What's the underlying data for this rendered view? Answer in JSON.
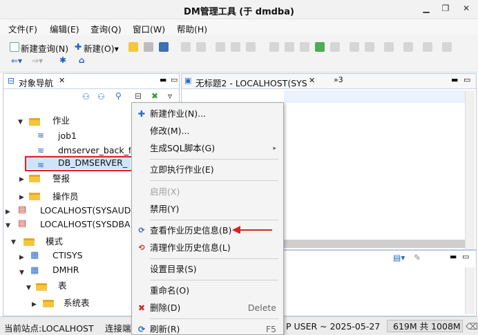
{
  "window": {
    "title": "DM管理工具 (于 dmdba)",
    "min_icon": "minimize-icon",
    "restore_icon": "restore-icon",
    "close_icon": "close-icon"
  },
  "menubar": [
    "文件(F)",
    "编辑(E)",
    "查询(Q)",
    "窗口(W)",
    "帮助(H)"
  ],
  "toolbar": {
    "new_query": "新建查询(N)",
    "new": "新建(O)▾"
  },
  "left_panel": {
    "tab_title": "对象导航",
    "tree": [
      {
        "label": "作业",
        "kind": "folder"
      },
      {
        "label": "job1",
        "kind": "job"
      },
      {
        "label": "dmserver_back_full",
        "kind": "job"
      },
      {
        "label": "DB_DMSERVER_",
        "kind": "job",
        "selected": true
      },
      {
        "label": "警报",
        "kind": "folder"
      },
      {
        "label": "操作员",
        "kind": "folder"
      },
      {
        "label": "LOCALHOST(SYSAUD",
        "kind": "server"
      },
      {
        "label": "LOCALHOST(SYSDBA",
        "kind": "server"
      },
      {
        "label": "模式",
        "kind": "folder"
      },
      {
        "label": "CTISYS",
        "kind": "schema"
      },
      {
        "label": "DMHR",
        "kind": "schema"
      },
      {
        "label": "表",
        "kind": "folder"
      },
      {
        "label": "系统表",
        "kind": "folder"
      }
    ]
  },
  "editor": {
    "tab_title": "无标题2 - LOCALHOST(SYS",
    "overflow": "»3"
  },
  "context_menu": {
    "items": [
      {
        "label": "新建作业(N)...",
        "icon": "plus-icon",
        "enabled": true,
        "accel": ""
      },
      {
        "label": "修改(M)...",
        "icon": "",
        "enabled": true,
        "accel": ""
      },
      {
        "label": "生成SQL脚本(G)",
        "icon": "",
        "enabled": true,
        "accel": "▸"
      },
      {
        "label": "立即执行作业(E)",
        "icon": "",
        "enabled": true,
        "accel": ""
      },
      {
        "label": "启用(X)",
        "icon": "",
        "enabled": false,
        "accel": ""
      },
      {
        "label": "禁用(Y)",
        "icon": "",
        "enabled": true,
        "accel": ""
      },
      {
        "label": "查看作业历史信息(B)",
        "icon": "history-view-icon",
        "enabled": true,
        "accel": ""
      },
      {
        "label": "清理作业历史信息(L)",
        "icon": "history-clear-icon",
        "enabled": true,
        "accel": ""
      },
      {
        "label": "设置目录(S)",
        "icon": "",
        "enabled": true,
        "accel": ""
      },
      {
        "label": "重命名(O)",
        "icon": "",
        "enabled": true,
        "accel": ""
      },
      {
        "label": "删除(D)",
        "icon": "delete-icon",
        "enabled": true,
        "accel": "Delete"
      },
      {
        "label": "刷新(R)",
        "icon": "refresh-icon",
        "enabled": true,
        "accel": "F5"
      }
    ]
  },
  "statusbar": {
    "site": "当前站点:LOCALHOST",
    "conn": "连接端",
    "user": "P USER ~ 2025-05-27",
    "mem": "619M 共 1008M"
  },
  "colors": {
    "accent": "#2a6ac8",
    "selection": "#cfe4fb",
    "highlight_box": "#e02020"
  }
}
